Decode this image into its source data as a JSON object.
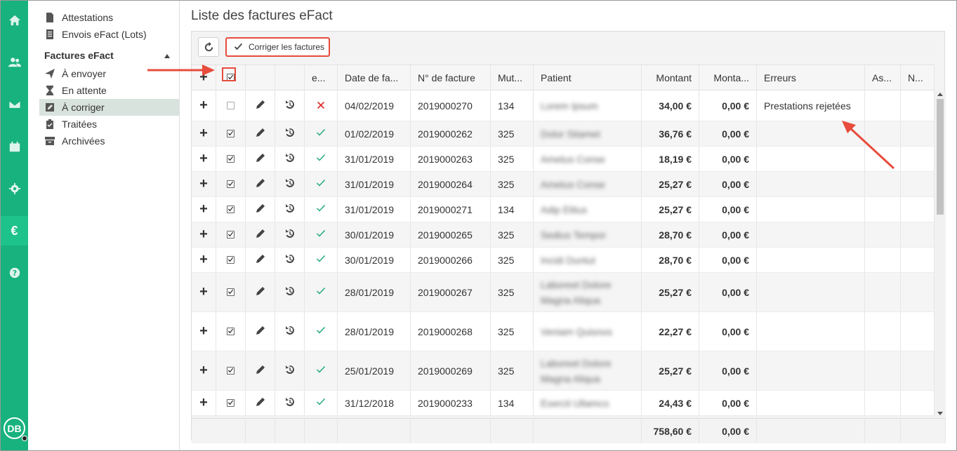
{
  "rail": {
    "euro_label": "€",
    "avatar_initials": "DB",
    "accent_color": "#17b27e"
  },
  "subnav": {
    "items_top": [
      {
        "label": "Attestations",
        "icon": "document-icon"
      },
      {
        "label": "Envois eFact (Lots)",
        "icon": "list-icon"
      }
    ],
    "section_title": "Factures eFact",
    "items": [
      {
        "label": "À envoyer",
        "icon": "paper-plane-icon"
      },
      {
        "label": "En attente",
        "icon": "hourglass-icon"
      },
      {
        "label": "À corriger",
        "icon": "edit-icon"
      },
      {
        "label": "Traitées",
        "icon": "clipboard-check-icon"
      },
      {
        "label": "Archivées",
        "icon": "archive-icon"
      }
    ]
  },
  "main": {
    "title": "Liste des factures eFact",
    "correct_button_label": "Corriger les factures"
  },
  "table": {
    "headers": {
      "status": "e...",
      "date": "Date de fa...",
      "invoice": "N° de facture",
      "mutuelle": "Mut...",
      "patient": "Patient",
      "amount": "Montant",
      "amount2": "Monta...",
      "errors": "Erreurs",
      "as": "As...",
      "n": "N..."
    },
    "rows": [
      {
        "checked": false,
        "status": "error",
        "date": "04/02/2019",
        "invoice": "2019000270",
        "mut": "134",
        "patient": "Lorem Ipsum",
        "amount": "34,00 €",
        "amount2": "0,00 €",
        "errors": "Prestations rejetées"
      },
      {
        "checked": true,
        "status": "ok",
        "date": "01/02/2019",
        "invoice": "2019000262",
        "mut": "325",
        "patient": "Dolor Sitamet",
        "amount": "36,76 €",
        "amount2": "0,00 €",
        "errors": ""
      },
      {
        "checked": true,
        "status": "ok",
        "date": "31/01/2019",
        "invoice": "2019000263",
        "mut": "325",
        "patient": "Ametus Conse",
        "amount": "18,19 €",
        "amount2": "0,00 €",
        "errors": ""
      },
      {
        "checked": true,
        "status": "ok",
        "date": "31/01/2019",
        "invoice": "2019000264",
        "mut": "325",
        "patient": "Ametus Conse",
        "amount": "25,27 €",
        "amount2": "0,00 €",
        "errors": ""
      },
      {
        "checked": true,
        "status": "ok",
        "date": "31/01/2019",
        "invoice": "2019000271",
        "mut": "134",
        "patient": "Adip Elitus",
        "amount": "25,27 €",
        "amount2": "0,00 €",
        "errors": ""
      },
      {
        "checked": true,
        "status": "ok",
        "date": "30/01/2019",
        "invoice": "2019000265",
        "mut": "325",
        "patient": "Sedius Tempor",
        "amount": "28,70 €",
        "amount2": "0,00 €",
        "errors": ""
      },
      {
        "checked": true,
        "status": "ok",
        "date": "30/01/2019",
        "invoice": "2019000266",
        "mut": "325",
        "patient": "Incidi Duntut",
        "amount": "28,70 €",
        "amount2": "0,00 €",
        "errors": ""
      },
      {
        "checked": true,
        "status": "ok",
        "date": "28/01/2019",
        "invoice": "2019000267",
        "mut": "325",
        "patient": "Laboreet Dolore Magna Aliqua",
        "amount": "25,27 €",
        "amount2": "0,00 €",
        "errors": ""
      },
      {
        "checked": true,
        "status": "ok",
        "date": "28/01/2019",
        "invoice": "2019000268",
        "mut": "325",
        "patient": "Veniam Quisnos",
        "amount": "22,27 €",
        "amount2": "0,00 €",
        "errors": ""
      },
      {
        "checked": true,
        "status": "ok",
        "date": "25/01/2019",
        "invoice": "2019000269",
        "mut": "325",
        "patient": "Laboreet Dolore Magna Aliqua",
        "amount": "25,27 €",
        "amount2": "0,00 €",
        "errors": ""
      },
      {
        "checked": true,
        "status": "ok",
        "date": "31/12/2018",
        "invoice": "2019000233",
        "mut": "134",
        "patient": "Exercit Ullamco",
        "amount": "24,43 €",
        "amount2": "0,00 €",
        "errors": ""
      }
    ],
    "totals": {
      "amount": "758,60 €",
      "amount2": "0,00 €"
    }
  },
  "colors": {
    "accent": "#17b27e",
    "ok": "#17a673",
    "error": "#e03030",
    "annotation": "#e74c3c"
  }
}
